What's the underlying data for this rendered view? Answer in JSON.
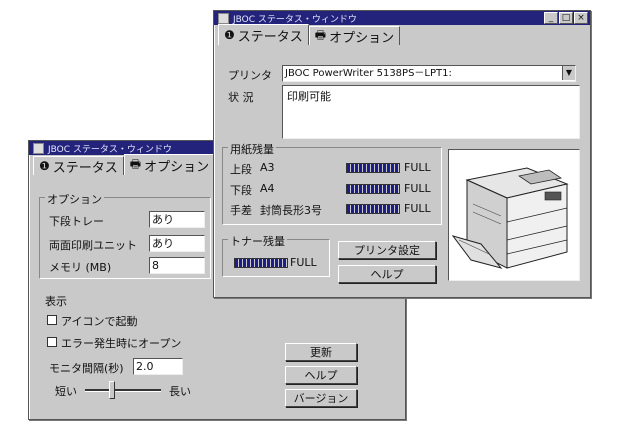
{
  "back_window": {
    "title": "JBOC ステータス・ウィンドウ",
    "tabs": [
      {
        "label": "ステータス",
        "icon": "info-icon"
      },
      {
        "label": "オプション",
        "icon": "printer-icon"
      }
    ],
    "options": {
      "group_label": "オプション",
      "tray_label": "下段トレー",
      "tray_value": "あり",
      "duplex_label": "両面印刷ユニット",
      "duplex_value": "あり",
      "memory_label": "メモリ (MB)",
      "memory_value": "8"
    },
    "display": {
      "group_label": "表示",
      "icon_start_label": "アイコンで起動",
      "error_open_label": "エラー発生時にオープン",
      "interval_label": "モニタ間隔(秒)",
      "interval_value": "2.0",
      "slider_min_label": "短い",
      "slider_max_label": "長い",
      "slider_level": 0.35
    },
    "buttons": {
      "update": "更新",
      "help": "ヘルプ",
      "version": "バージョン"
    }
  },
  "front_window": {
    "title": "JBOC ステータス・ウィンドウ",
    "tabs": [
      {
        "label": "ステータス",
        "icon": "info-icon"
      },
      {
        "label": "オプション",
        "icon": "printer-icon"
      }
    ],
    "printer_label": "プリンタ",
    "printer_value": "JBOC PowerWriter 5138PS－LPT1:",
    "status_label": "状 況",
    "status_value": "印刷可能",
    "paper": {
      "group_label": "用紙残量",
      "rows": [
        {
          "tray": "上段",
          "size": "A3",
          "status": "FULL"
        },
        {
          "tray": "下段",
          "size": "A4",
          "status": "FULL"
        },
        {
          "tray": "手差",
          "size": "封筒長形3号",
          "status": "FULL"
        }
      ]
    },
    "toner": {
      "group_label": "トナー残量",
      "status": "FULL"
    },
    "buttons": {
      "printer_settings": "プリンタ設定",
      "help": "ヘルプ"
    }
  }
}
